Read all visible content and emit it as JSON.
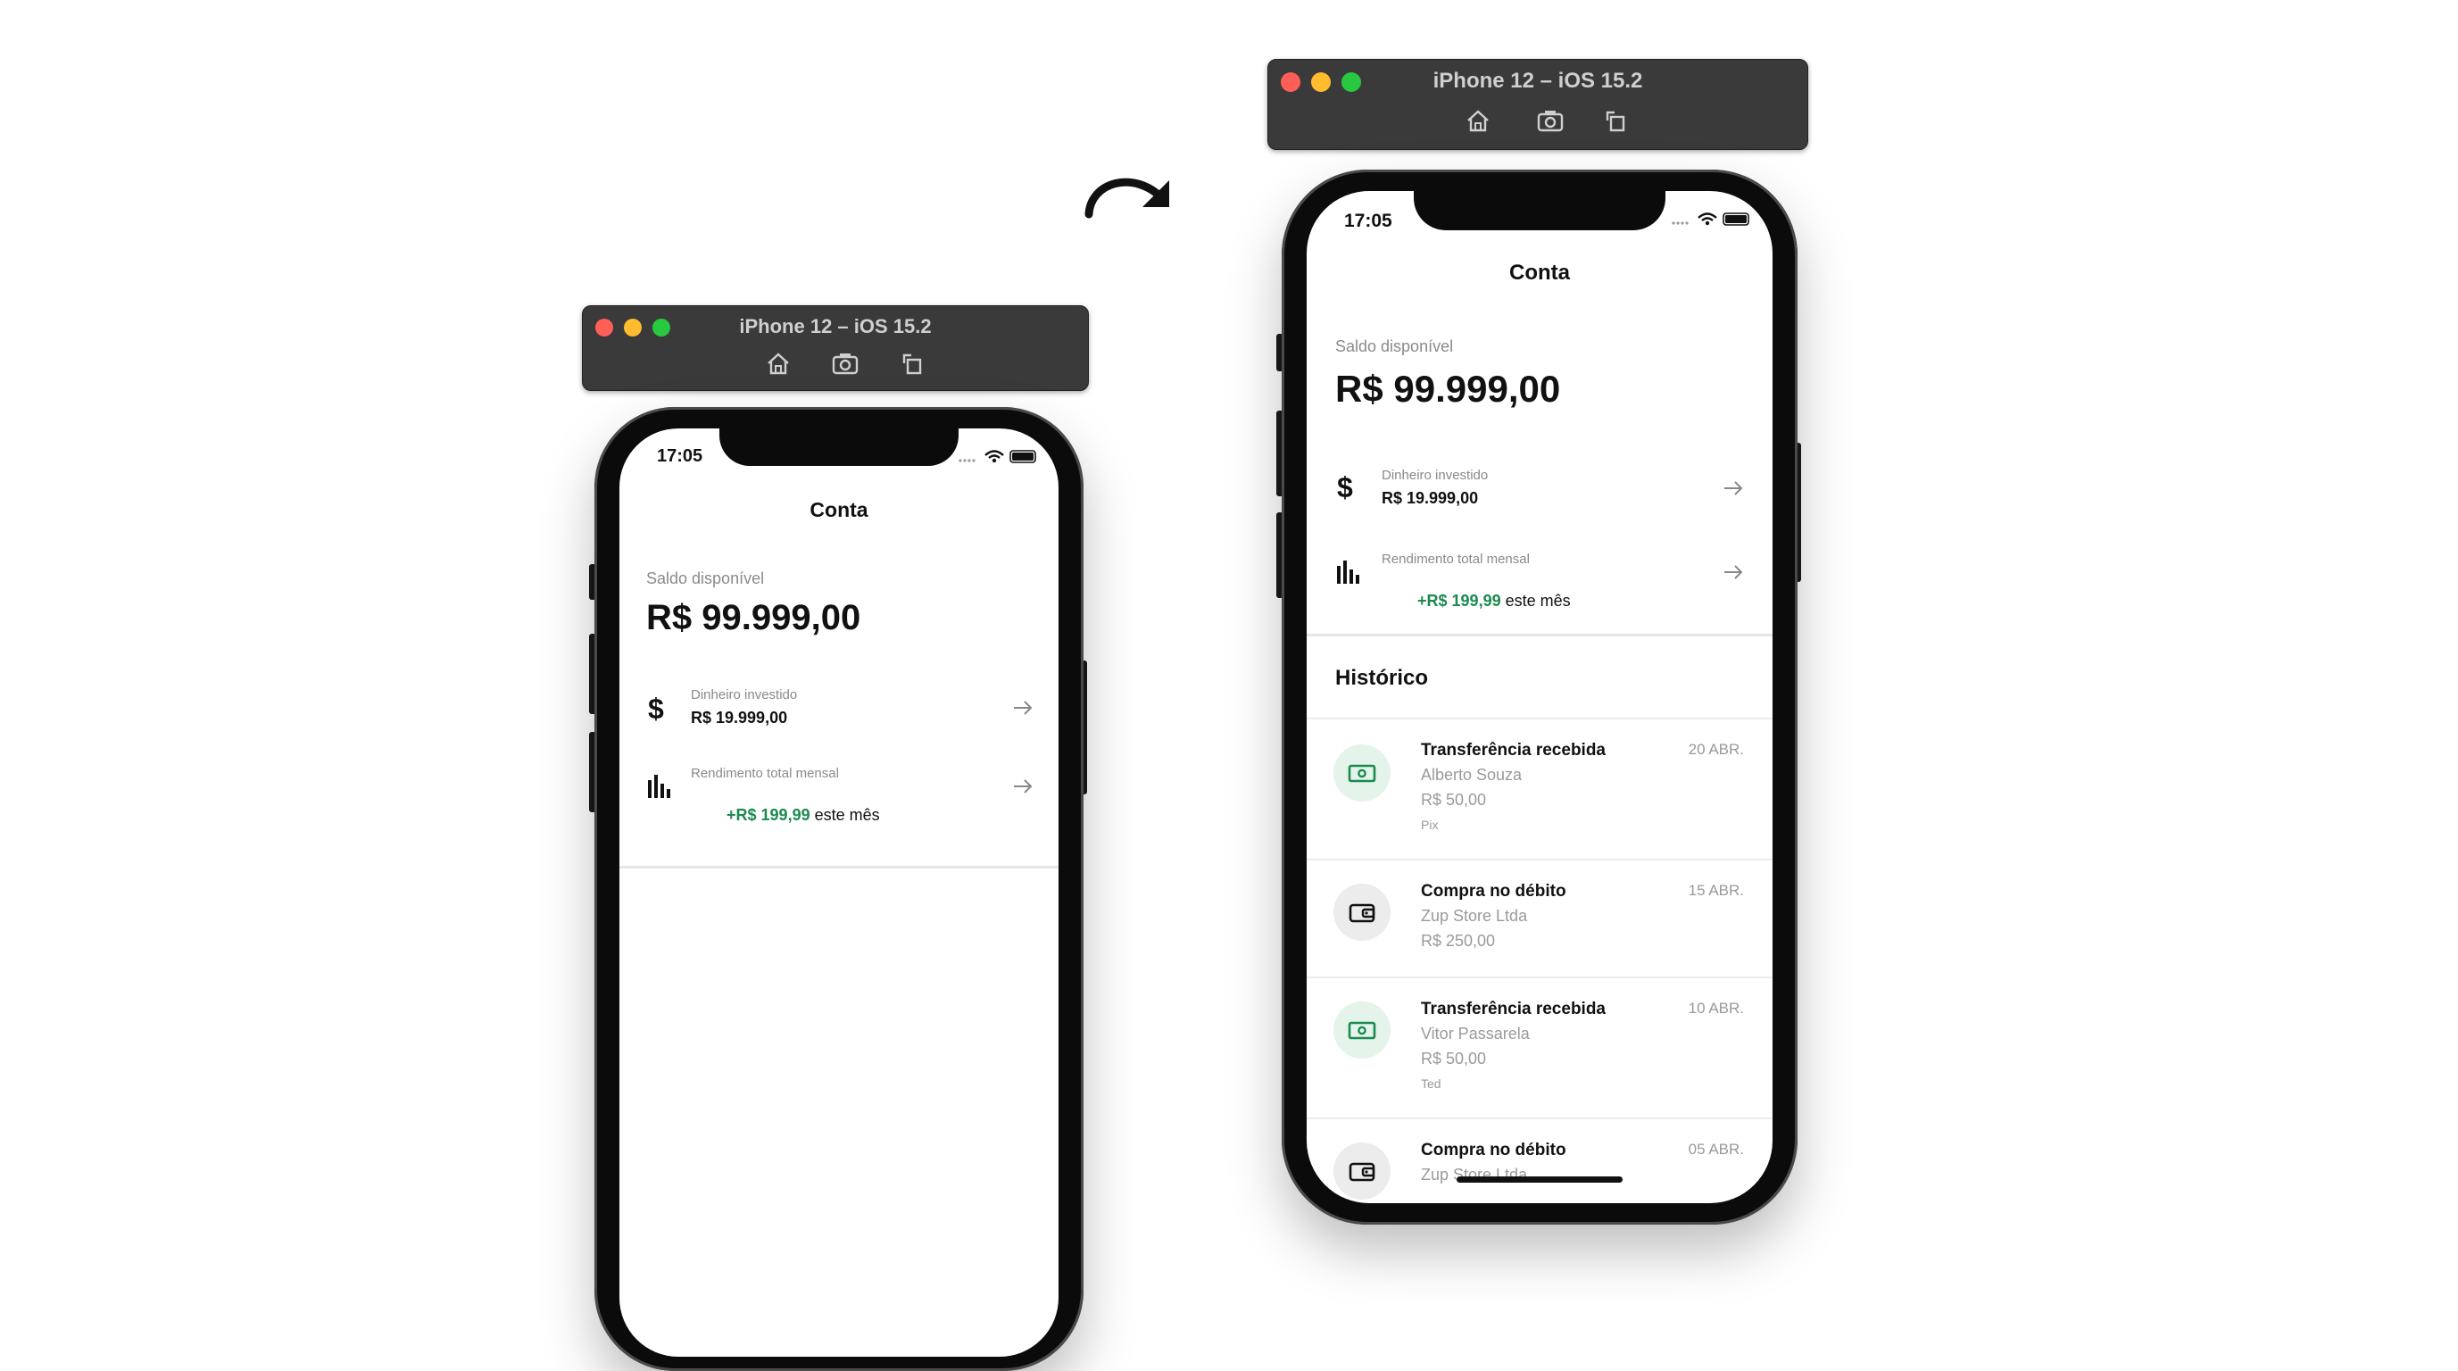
{
  "simulator": {
    "title": "iPhone 12 – iOS 15.2",
    "toolbar_icons": [
      "home-icon",
      "screenshot-icon",
      "rotate-icon"
    ]
  },
  "status_bar": {
    "time": "17:05"
  },
  "nav": {
    "title": "Conta"
  },
  "balance": {
    "label": "Saldo disponível",
    "value": "R$ 99.999,00"
  },
  "summary": [
    {
      "icon": "dollar-icon",
      "label": "Dinheiro investido",
      "value": "R$ 19.999,00",
      "value_suffix": ""
    },
    {
      "icon": "bar-chart-icon",
      "label": "Rendimento total mensal",
      "value": "+R$ 199,99",
      "value_suffix": " este mês"
    }
  ],
  "history": {
    "title": "Histórico",
    "items": [
      {
        "icon": "money-bill-icon",
        "title": "Transferência recebida",
        "subtitle": "Alberto Souza",
        "amount": "R$ 50,00",
        "method": "Pix",
        "date": "20 ABR."
      },
      {
        "icon": "wallet-icon",
        "title": "Compra no débito",
        "subtitle": "Zup Store Ltda",
        "amount": "R$ 250,00",
        "method": "",
        "date": "15 ABR."
      },
      {
        "icon": "money-bill-icon",
        "title": "Transferência recebida",
        "subtitle": "Vitor Passarela",
        "amount": "R$ 50,00",
        "method": "Ted",
        "date": "10 ABR."
      },
      {
        "icon": "wallet-icon",
        "title": "Compra no débito",
        "subtitle": "Zup Store Ltda",
        "amount": "",
        "method": "",
        "date": "05 ABR."
      }
    ]
  },
  "colors": {
    "accent_green": "#1a8a4e",
    "green_bg": "#e4f4ea",
    "gray_bg": "#ececec"
  }
}
